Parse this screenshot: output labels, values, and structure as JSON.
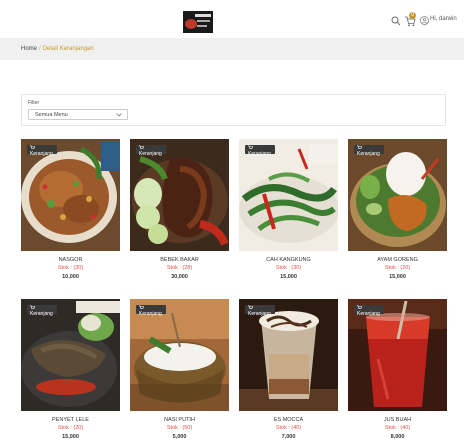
{
  "header": {
    "logo": "restaurant-logo",
    "cart_count": "0",
    "greeting": "Hi, darwin"
  },
  "breadcrumb": {
    "home": "Home",
    "separator": "/",
    "current": "Detail Keranjangan"
  },
  "filter": {
    "label": "Filter",
    "selected": "Semua Menu"
  },
  "product_tag": "Keranjang",
  "products": [
    {
      "name": "NASGOR",
      "stock": "Stok : (30)",
      "price": "10,000"
    },
    {
      "name": "BEBEK BAKAR",
      "stock": "Stok : (28)",
      "price": "30,000"
    },
    {
      "name": "CAH KANGKUNG",
      "stock": "Stok : (30)",
      "price": "15,000"
    },
    {
      "name": "AYAM GORENG",
      "stock": "Stok : (20)",
      "price": "15,000"
    },
    {
      "name": "PENYET LELE",
      "stock": "Stok : (20)",
      "price": "15,000"
    },
    {
      "name": "NASI PUTIH",
      "stock": "Stok : (50)",
      "price": "5,000"
    },
    {
      "name": "ES MOCCA",
      "stock": "Stok : (40)",
      "price": "7,000"
    },
    {
      "name": "JUS BUAH",
      "stock": "Stok : (40)",
      "price": "8,000"
    }
  ],
  "colors": {
    "accent": "#c49a2c",
    "stock": "#e05050",
    "breadcrumb_bg": "#f0f0f0"
  }
}
